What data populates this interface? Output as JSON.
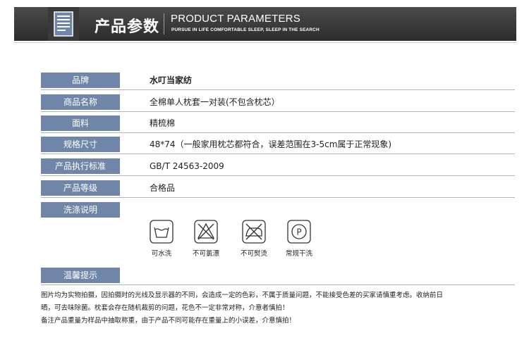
{
  "header": {
    "title_cn": "产品参数",
    "title_en": "PRODUCT PARAMETERS",
    "subtitle": "PURSUE IN LIFE COMFORTABLE SLEEP, SLEEP IN THE SEARCH",
    "icon": "document-icon"
  },
  "params": [
    {
      "label": "品牌",
      "value": "水叮当家纺"
    },
    {
      "label": "商品名称",
      "value": "全棉单人枕套一对装(不包含枕芯）"
    },
    {
      "label": "面料",
      "value": "精梳棉"
    },
    {
      "label": "规格尺寸",
      "value": "48*74（一般家用枕芯都符合，误差范围在3-5cm属于正常现象)"
    },
    {
      "label": "产品执行标准",
      "value": "GB/T 24563-2009"
    },
    {
      "label": "产品等级",
      "value": "合格品"
    }
  ],
  "care": {
    "label": "洗涤说明",
    "items": [
      {
        "icon": "washable-icon",
        "label": "可水洗"
      },
      {
        "icon": "no-bleach-icon",
        "label": "不可氯漂"
      },
      {
        "icon": "no-iron-icon",
        "label": "不可熨烫"
      },
      {
        "icon": "dry-clean-icon",
        "label": "常规干洗"
      }
    ]
  },
  "notice": {
    "label": "温馨提示",
    "lines": [
      "图片均为实物拍摄，因拍摄时的光线及显示器的不同，会造成一定的色彩，不属于质量问题，不能接受色差的买家请慎重考虑。收纳前日",
      "晒，可去味除菌。枕套会存在随机裁剪的问题，花色不一定非常对称，介意者慎拍！",
      "备注产品重量为样品中抽取称重，由于产品不同可能存在重量上的小误差，介意慎拍！"
    ]
  },
  "colors": {
    "header_bg": "#3a3a3a",
    "label_bg": "#6f86a8"
  }
}
